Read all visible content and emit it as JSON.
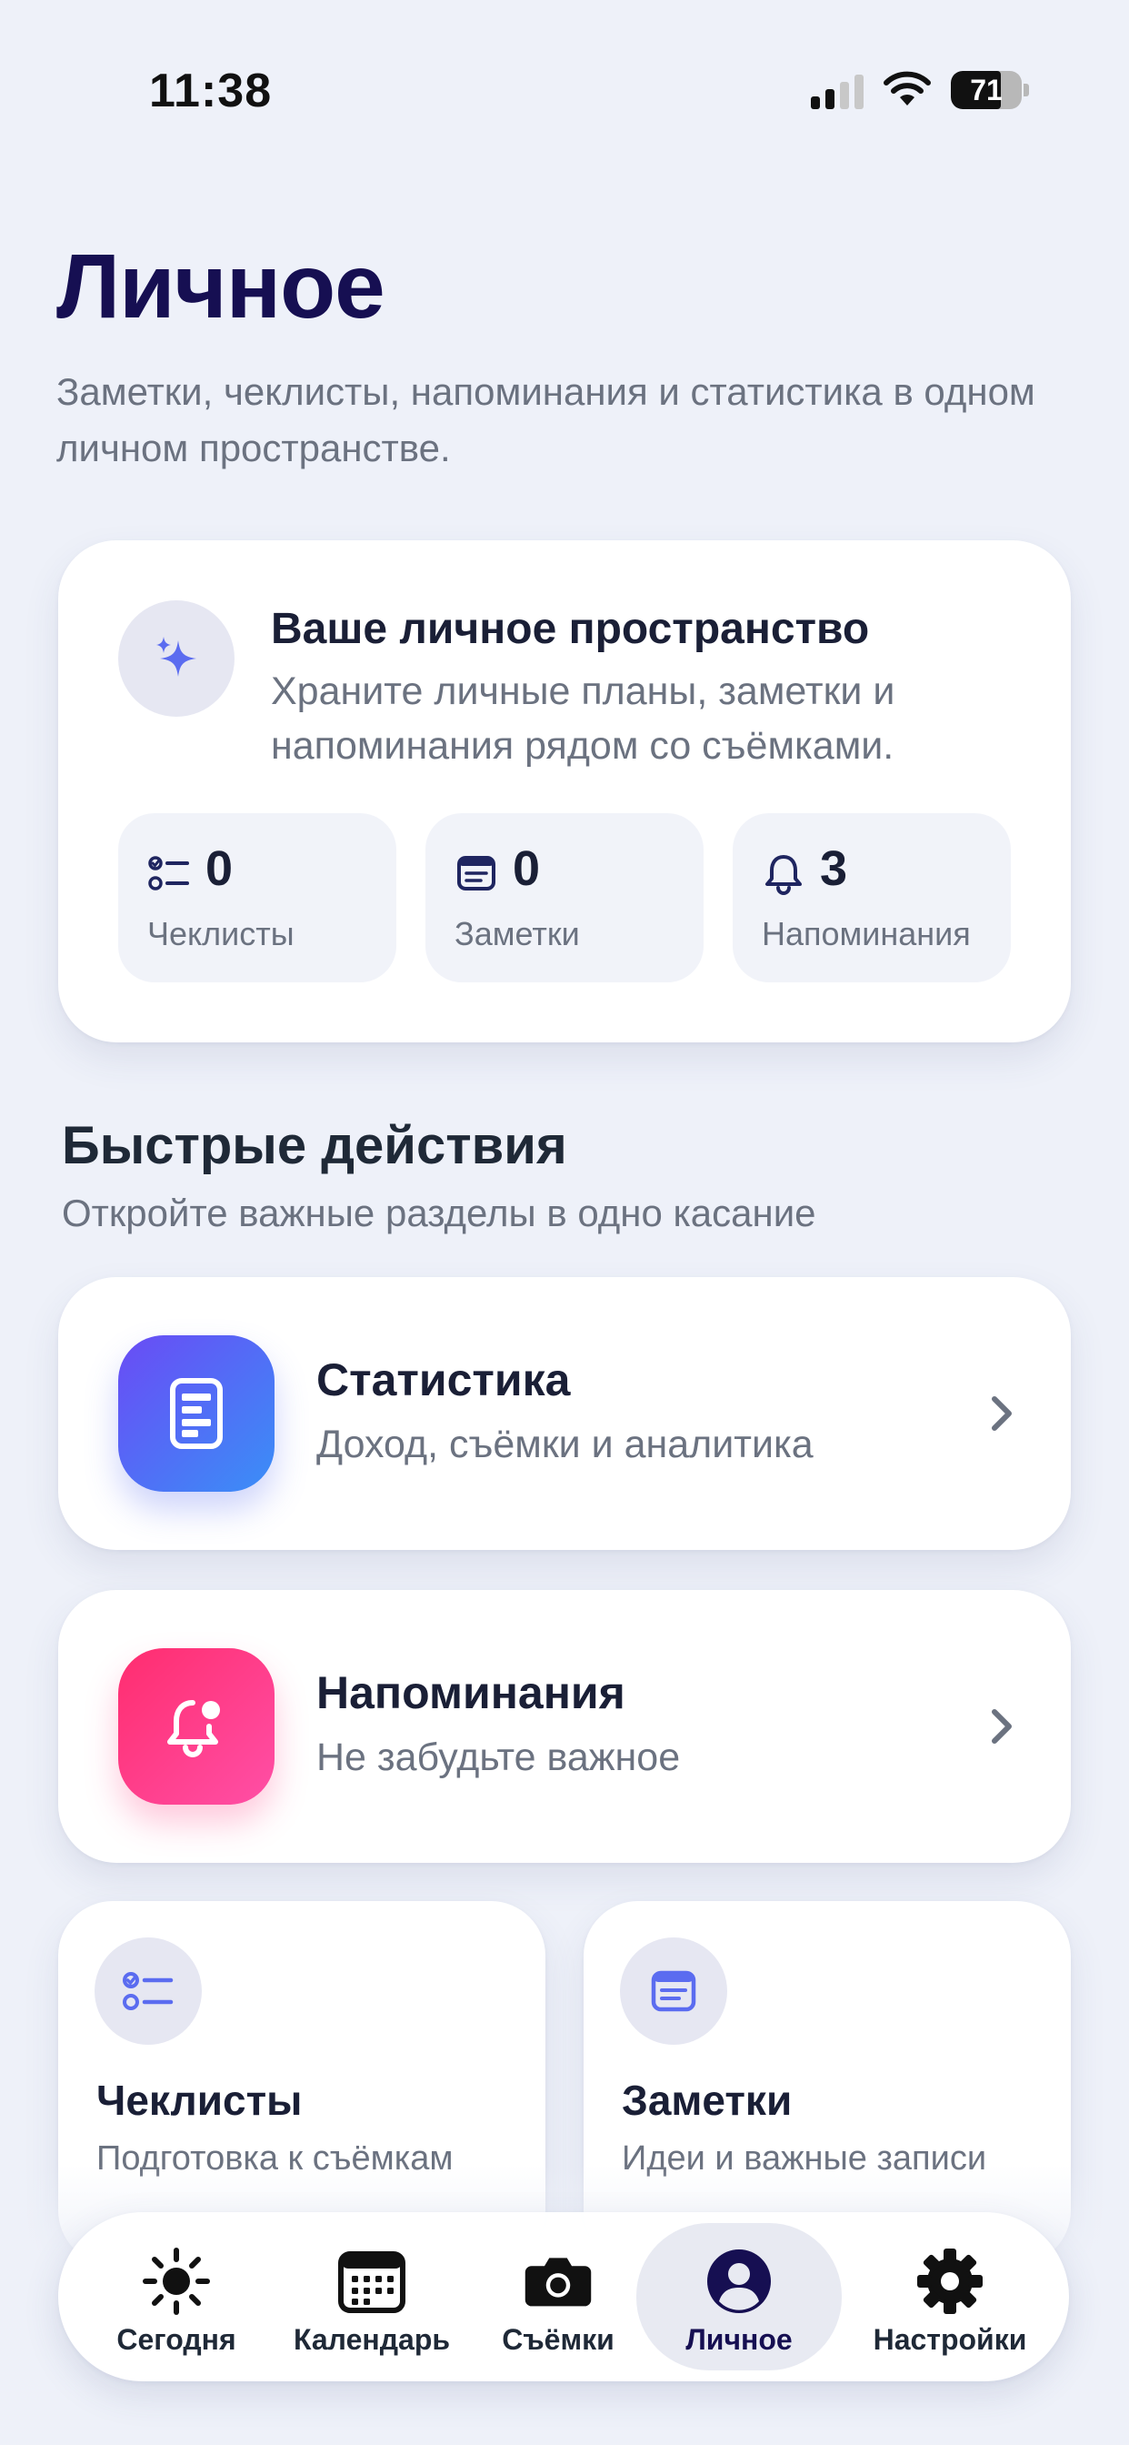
{
  "status_bar": {
    "time": "11:38",
    "battery": "71",
    "battery_level": 0.71
  },
  "header": {
    "title": "Личное",
    "subtitle": "Заметки, чеклисты, напоминания и статистика в одном личном пространстве."
  },
  "space_card": {
    "title": "Ваше личное пространство",
    "description": "Храните личные планы, заметки и напоминания рядом со съёмками.",
    "icon": "sparkles-icon",
    "stats": [
      {
        "icon": "checklist-icon",
        "value": "0",
        "label": "Чеклисты"
      },
      {
        "icon": "note-icon",
        "value": "0",
        "label": "Заметки"
      },
      {
        "icon": "bell-icon",
        "value": "3",
        "label": "Напоминания"
      }
    ]
  },
  "quick_actions": {
    "title": "Быстрые действия",
    "subtitle": "Откройте важные разделы в одно касание",
    "items": [
      {
        "title": "Статистика",
        "subtitle": "Доход, съёмки и аналитика",
        "icon": "document-icon"
      },
      {
        "title": "Напоминания",
        "subtitle": "Не забудьте важное",
        "icon": "bell-badge-icon"
      }
    ],
    "tiles": [
      {
        "title": "Чеклисты",
        "subtitle": "Подготовка к съёмкам",
        "icon": "checklist-icon"
      },
      {
        "title": "Заметки",
        "subtitle": "Идеи и важные записи",
        "icon": "note-icon"
      }
    ]
  },
  "tab_bar": {
    "tabs": [
      {
        "label": "Сегодня",
        "icon": "sun-icon"
      },
      {
        "label": "Календарь",
        "icon": "calendar-icon"
      },
      {
        "label": "Съёмки",
        "icon": "camera-icon"
      },
      {
        "label": "Личное",
        "icon": "person-icon"
      },
      {
        "label": "Настройки",
        "icon": "gear-icon"
      }
    ],
    "active_index": 3
  },
  "colors": {
    "title": "#160f52",
    "accent_purple": "#6a4bf5",
    "accent_blue": "#3a8ff7",
    "accent_pink": "#ff2d6f",
    "icon_blue": "#5b6cf0",
    "text_secondary": "#6b7280"
  }
}
